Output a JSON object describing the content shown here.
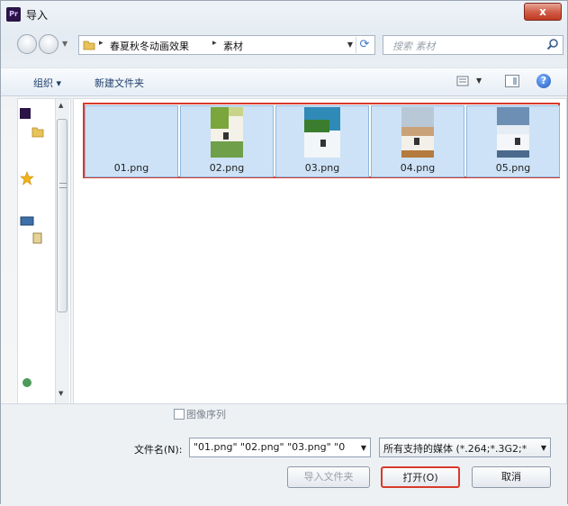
{
  "window": {
    "title": "导入",
    "app_icon": "Pr",
    "close_glyph": "x"
  },
  "address": {
    "crumbs": [
      "春夏秋冬动画效果",
      "素材"
    ],
    "separator": "▸",
    "search_placeholder": "搜索 素材"
  },
  "toolbar": {
    "organize": "组织 ▾",
    "new_folder": "新建文件夹",
    "help": "?"
  },
  "files": [
    {
      "name": "01.png",
      "thumb": "blank"
    },
    {
      "name": "02.png",
      "thumb": "green-cover"
    },
    {
      "name": "03.png",
      "thumb": "sky-tree"
    },
    {
      "name": "04.png",
      "thumb": "autumn"
    },
    {
      "name": "05.png",
      "thumb": "winter"
    }
  ],
  "bottom": {
    "image_sequence_label": "图像序列",
    "filename_label": "文件名(N):",
    "filename_value": "\"01.png\" \"02.png\" \"03.png\" \"0",
    "filter_value": "所有支持的媒体 (*.264;*.3G2;*",
    "import_folder_label": "导入文件夹",
    "open_label": "打开(O)",
    "cancel_label": "取消"
  },
  "colors": {
    "highlight": "#d83a2a",
    "selection": "#cde2f6"
  }
}
